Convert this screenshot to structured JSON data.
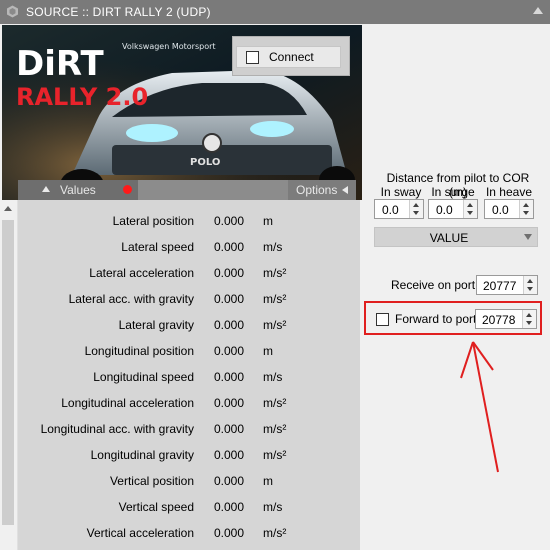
{
  "window": {
    "title": "SOURCE :: DIRT RALLY 2 (UDP)",
    "logo_icon": "hexagon-logo-icon",
    "collapse_icon": "triangle-up-icon"
  },
  "banner": {
    "logo_text_line1": "DiRT",
    "logo_text_line2": "RALLY 2.0",
    "car_text": "Volkswagen Motorsport",
    "plate_text": "POLO"
  },
  "connect": {
    "label": "Connect",
    "checked": false
  },
  "tabs": {
    "values_label": "Values",
    "options_label": "Options",
    "status_color": "#ff1a1a"
  },
  "values": [
    {
      "name": "Lateral position",
      "value": "0.000",
      "unit": "m"
    },
    {
      "name": "Lateral speed",
      "value": "0.000",
      "unit": "m/s"
    },
    {
      "name": "Lateral acceleration",
      "value": "0.000",
      "unit": "m/s²"
    },
    {
      "name": "Lateral acc. with gravity",
      "value": "0.000",
      "unit": "m/s²"
    },
    {
      "name": "Lateral gravity",
      "value": "0.000",
      "unit": "m/s²"
    },
    {
      "name": "Longitudinal position",
      "value": "0.000",
      "unit": "m"
    },
    {
      "name": "Longitudinal speed",
      "value": "0.000",
      "unit": "m/s"
    },
    {
      "name": "Longitudinal acceleration",
      "value": "0.000",
      "unit": "m/s²"
    },
    {
      "name": "Longitudinal acc. with gravity",
      "value": "0.000",
      "unit": "m/s²"
    },
    {
      "name": "Longitudinal gravity",
      "value": "0.000",
      "unit": "m/s²"
    },
    {
      "name": "Vertical position",
      "value": "0.000",
      "unit": "m"
    },
    {
      "name": "Vertical speed",
      "value": "0.000",
      "unit": "m/s"
    },
    {
      "name": "Vertical acceleration",
      "value": "0.000",
      "unit": "m/s²"
    }
  ],
  "options": {
    "distance_title": "Distance from pilot to COR (m)",
    "sway_label": "In sway",
    "surge_label": "In surge",
    "heave_label": "In heave",
    "sway_value": "0.0",
    "surge_value": "0.0",
    "heave_value": "0.0",
    "mode_value": "VALUE",
    "receive_label": "Receive on port",
    "receive_port": "20777",
    "forward_label": "Forward to port",
    "forward_port": "20778",
    "forward_checked": false
  },
  "annotation": {
    "color": "#e01f1f"
  }
}
